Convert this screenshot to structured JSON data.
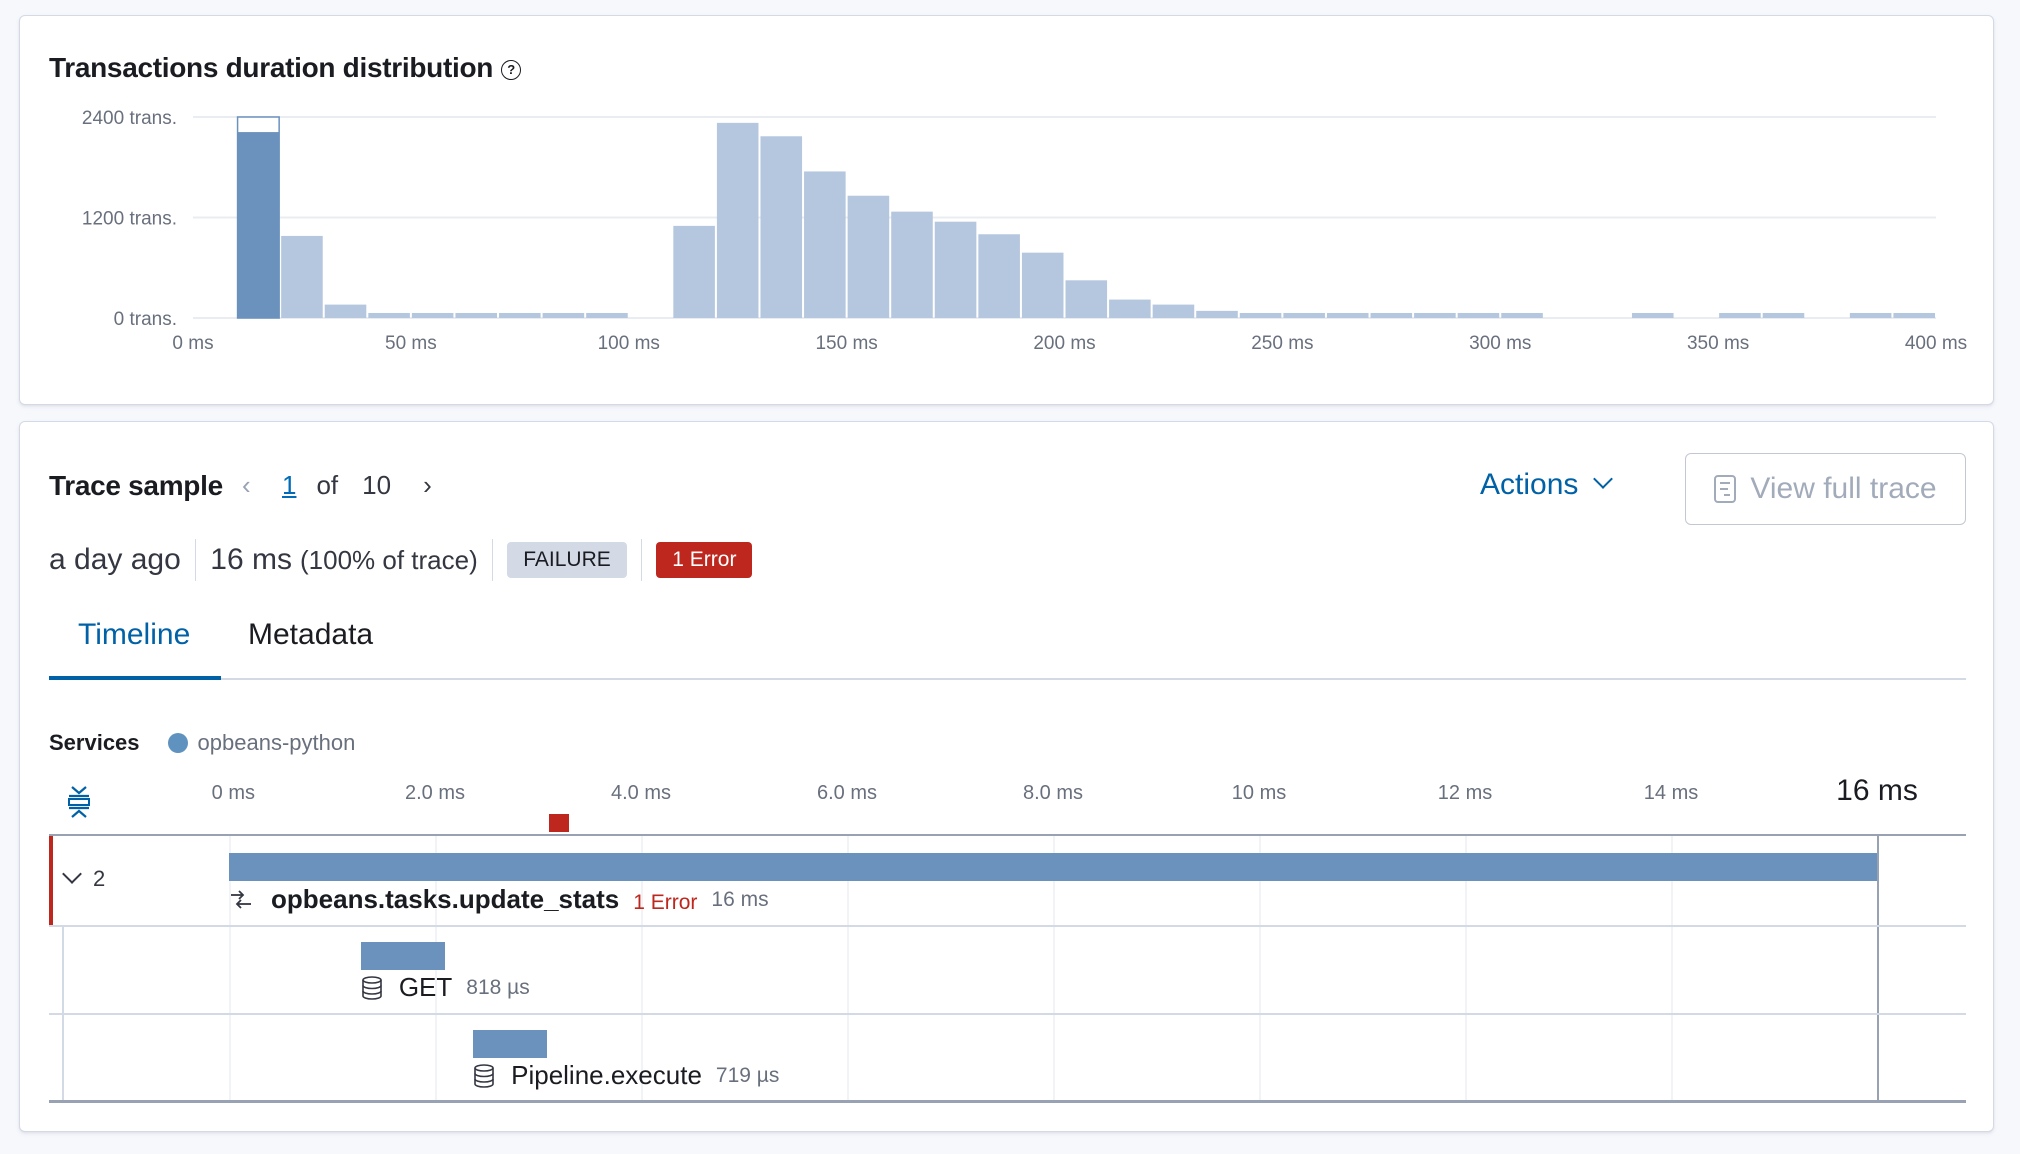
{
  "histogram_card": {
    "title": "Transactions duration distribution",
    "help_icon": "question-circle-icon"
  },
  "chart_data": {
    "type": "bar",
    "title": "Transactions duration distribution",
    "xlabel": "",
    "ylabel": "",
    "x_unit": "ms",
    "bin_width_ms": 10,
    "xlim": [
      0,
      400
    ],
    "ylim": [
      0,
      2400
    ],
    "x_ticks": [
      "0 ms",
      "50 ms",
      "100 ms",
      "150 ms",
      "200 ms",
      "250 ms",
      "300 ms",
      "350 ms",
      "400 ms"
    ],
    "y_ticks": [
      "0 trans.",
      "1200 trans.",
      "2400 trans."
    ],
    "grid": true,
    "selected_bin_start_ms": 10,
    "bins": [
      {
        "start": 10,
        "count": 2220,
        "selected": true
      },
      {
        "start": 20,
        "count": 980
      },
      {
        "start": 30,
        "count": 160
      },
      {
        "start": 40,
        "count": 60
      },
      {
        "start": 50,
        "count": 60
      },
      {
        "start": 60,
        "count": 60
      },
      {
        "start": 70,
        "count": 60
      },
      {
        "start": 80,
        "count": 60
      },
      {
        "start": 90,
        "count": 60
      },
      {
        "start": 110,
        "count": 1100
      },
      {
        "start": 120,
        "count": 2330
      },
      {
        "start": 130,
        "count": 2170
      },
      {
        "start": 140,
        "count": 1750
      },
      {
        "start": 150,
        "count": 1460
      },
      {
        "start": 160,
        "count": 1270
      },
      {
        "start": 170,
        "count": 1150
      },
      {
        "start": 180,
        "count": 1000
      },
      {
        "start": 190,
        "count": 780
      },
      {
        "start": 200,
        "count": 450
      },
      {
        "start": 210,
        "count": 220
      },
      {
        "start": 220,
        "count": 160
      },
      {
        "start": 230,
        "count": 85
      },
      {
        "start": 240,
        "count": 60
      },
      {
        "start": 250,
        "count": 60
      },
      {
        "start": 260,
        "count": 60
      },
      {
        "start": 270,
        "count": 60
      },
      {
        "start": 280,
        "count": 60
      },
      {
        "start": 290,
        "count": 60
      },
      {
        "start": 300,
        "count": 60
      },
      {
        "start": 330,
        "count": 60
      },
      {
        "start": 350,
        "count": 60
      },
      {
        "start": 360,
        "count": 60
      },
      {
        "start": 380,
        "count": 60
      },
      {
        "start": 390,
        "count": 60
      }
    ],
    "colors": {
      "bar": "#b5c7de",
      "selected": "#6b91bd"
    }
  },
  "trace": {
    "title": "Trace sample",
    "pager": {
      "current": "1",
      "of_label": "of",
      "total": "10",
      "prev_icon": "chevron-left-icon",
      "next_icon": "chevron-right-icon"
    },
    "actions_label": "Actions",
    "view_full_trace_label": "View full trace",
    "meta": {
      "timestamp": "a day ago",
      "duration": "16 ms",
      "percent": "(100% of trace)",
      "outcome_badge": "FAILURE",
      "error_badge": "1 Error"
    },
    "tabs": [
      {
        "label": "Timeline",
        "active": true
      },
      {
        "label": "Metadata",
        "active": false
      }
    ],
    "services_label": "Services",
    "services": [
      {
        "name": "opbeans-python",
        "color": "#6092c0"
      }
    ],
    "timeline": {
      "max_ms": 16,
      "ticks": [
        {
          "ms": 0,
          "label": "0 ms"
        },
        {
          "ms": 2,
          "label": "2.0 ms"
        },
        {
          "ms": 4,
          "label": "4.0 ms"
        },
        {
          "ms": 6,
          "label": "6.0 ms"
        },
        {
          "ms": 8,
          "label": "8.0 ms"
        },
        {
          "ms": 10,
          "label": "10 ms"
        },
        {
          "ms": 12,
          "label": "12 ms"
        },
        {
          "ms": 14,
          "label": "14 ms"
        },
        {
          "ms": 16,
          "label": "16 ms"
        }
      ],
      "error_marker_ms": 3.2,
      "collapse_icon": "collapse-all-icon",
      "rows": [
        {
          "kind": "transaction",
          "icon": "transaction-arrows-icon",
          "name": "opbeans.tasks.update_stats",
          "error_label": "1 Error",
          "duration": "16 ms",
          "start_ms": 0,
          "duration_ms": 16,
          "children_count": "2",
          "expanded": true
        },
        {
          "kind": "span",
          "icon": "database-icon",
          "name": "GET",
          "duration": "818 µs",
          "start_ms": 1.28,
          "duration_ms": 0.818
        },
        {
          "kind": "span",
          "icon": "database-icon",
          "name": "Pipeline.execute",
          "duration": "719 µs",
          "start_ms": 2.37,
          "duration_ms": 0.719
        }
      ]
    },
    "colors": {
      "accent": "#0061a6",
      "danger": "#bd271e",
      "span": "#6b91bd"
    }
  }
}
